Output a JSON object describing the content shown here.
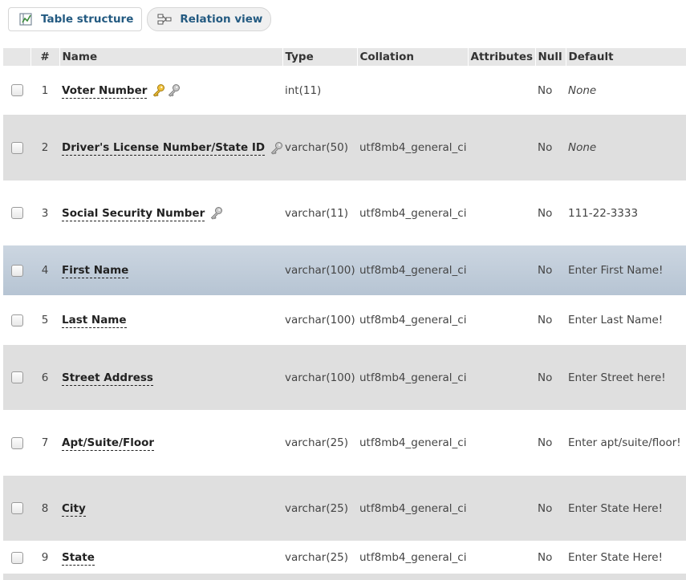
{
  "tabs": {
    "structure_label": "Table structure",
    "relation_label": "Relation view"
  },
  "header": {
    "num": "#",
    "name": "Name",
    "type": "Type",
    "collation": "Collation",
    "attributes": "Attributes",
    "null": "Null",
    "default": "Default"
  },
  "rows": [
    {
      "num": "1",
      "name": "Voter Number",
      "type": "int(11)",
      "collation": "",
      "attributes": "",
      "null": "No",
      "default": "None",
      "keys": [
        "primary-key-icon",
        "index-key-icon"
      ]
    },
    {
      "num": "2",
      "name": "Driver's License Number/State ID",
      "type": "varchar(50)",
      "collation": "utf8mb4_general_ci",
      "attributes": "",
      "null": "No",
      "default": "None",
      "keys": [
        "index-key-icon"
      ]
    },
    {
      "num": "3",
      "name": "Social Security Number",
      "type": "varchar(11)",
      "collation": "utf8mb4_general_ci",
      "attributes": "",
      "null": "No",
      "default": "111-22-3333",
      "keys": [
        "index-key-icon"
      ]
    },
    {
      "num": "4",
      "name": "First Name",
      "type": "varchar(100)",
      "collation": "utf8mb4_general_ci",
      "attributes": "",
      "null": "No",
      "default": "Enter First Name!",
      "keys": []
    },
    {
      "num": "5",
      "name": "Last Name",
      "type": "varchar(100)",
      "collation": "utf8mb4_general_ci",
      "attributes": "",
      "null": "No",
      "default": "Enter Last Name!",
      "keys": []
    },
    {
      "num": "6",
      "name": "Street Address",
      "type": "varchar(100)",
      "collation": "utf8mb4_general_ci",
      "attributes": "",
      "null": "No",
      "default": "Enter Street here!",
      "keys": []
    },
    {
      "num": "7",
      "name": "Apt/Suite/Floor",
      "type": "varchar(25)",
      "collation": "utf8mb4_general_ci",
      "attributes": "",
      "null": "No",
      "default": "Enter apt/suite/floor!",
      "keys": []
    },
    {
      "num": "8",
      "name": "City",
      "type": "varchar(25)",
      "collation": "utf8mb4_general_ci",
      "attributes": "",
      "null": "No",
      "default": "Enter State Here!",
      "keys": []
    },
    {
      "num": "9",
      "name": "State",
      "type": "varchar(25)",
      "collation": "utf8mb4_general_ci",
      "attributes": "",
      "null": "No",
      "default": "Enter State Here!",
      "keys": []
    }
  ],
  "colors": {
    "link_blue": "#235a81",
    "row_alt": "#dfdfdf",
    "row_highlight": "#bfcad7",
    "primary_key_gold": "#e0b020",
    "index_key_gray": "#9a9a9a"
  }
}
